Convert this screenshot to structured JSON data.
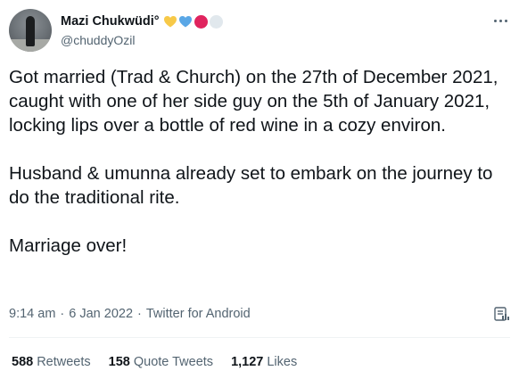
{
  "author": {
    "display_name": "Mazi Chukwüdi°",
    "handle": "@chuddyOzil",
    "emoji_colors": [
      "#f7c948",
      "#5aa7e6",
      "#e0245e",
      "#e1e8ed"
    ]
  },
  "tweet": {
    "text": "Got married (Trad & Church) on the 27th of December 2021, caught with one of her side guy on the 5th of January 2021, locking lips over a bottle of red wine in a cozy environ.\n\nHusband & umunna already set to embark on the journey to do the traditional rite.\n\nMarriage over!",
    "time": "9:14 am",
    "date": "6 Jan 2022",
    "source": "Twitter for Android",
    "separator": "·"
  },
  "stats": [
    {
      "value": "588",
      "label": "Retweets"
    },
    {
      "value": "158",
      "label": "Quote Tweets"
    },
    {
      "value": "1,127",
      "label": "Likes"
    }
  ],
  "icons": {
    "more": "more-icon",
    "analytics": "analytics-icon"
  }
}
